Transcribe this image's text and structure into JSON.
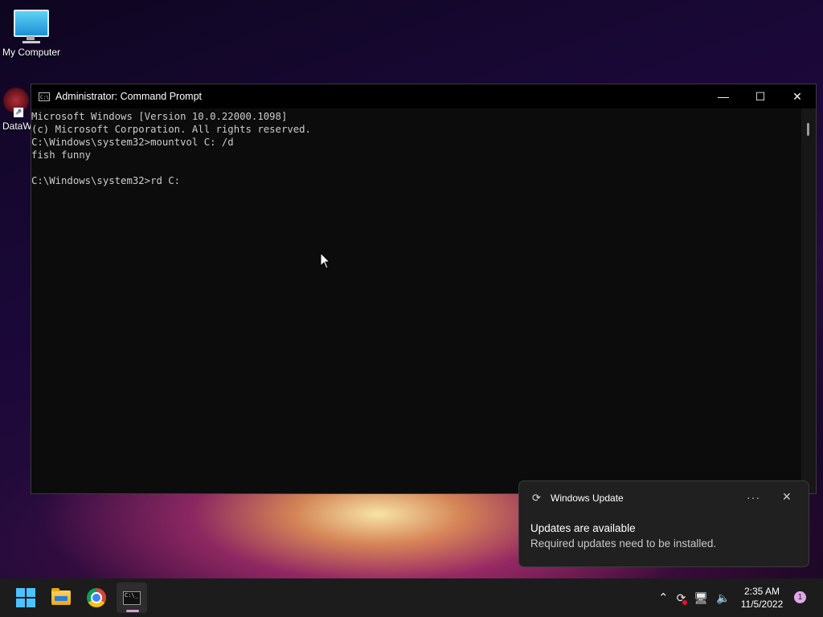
{
  "desktop": {
    "icons": [
      {
        "label": "My Computer",
        "icon": "computer-icon"
      },
      {
        "label": "DataW",
        "icon": "datawrapper-icon"
      }
    ]
  },
  "cmd_window": {
    "title": "Administrator: Command Prompt",
    "icon": "cmd-icon",
    "icon_glyph": "C:\\_",
    "controls": {
      "minimize": "—",
      "maximize": "☐",
      "close": "✕"
    },
    "lines": [
      "Microsoft Windows [Version 10.0.22000.1098]",
      "(c) Microsoft Corporation. All rights reserved.",
      "C:\\Windows\\system32>mountvol C: /d",
      "fish funny",
      "",
      "C:\\Windows\\system32>rd C:"
    ]
  },
  "toast": {
    "app": "Windows Update",
    "app_icon": "sync-icon",
    "more": "···",
    "close": "✕",
    "title": "Updates are available",
    "body": "Required updates need to be installed."
  },
  "taskbar": {
    "items": [
      {
        "name": "start-button",
        "icon": "windows-logo-icon"
      },
      {
        "name": "file-explorer",
        "icon": "folder-icon"
      },
      {
        "name": "chrome",
        "icon": "chrome-icon"
      },
      {
        "name": "command-prompt",
        "icon": "terminal-icon",
        "active": true
      }
    ],
    "tray": {
      "chevron": "^",
      "clock_time": "2:35 AM",
      "clock_date": "11/5/2022",
      "notification_count": "1"
    }
  }
}
